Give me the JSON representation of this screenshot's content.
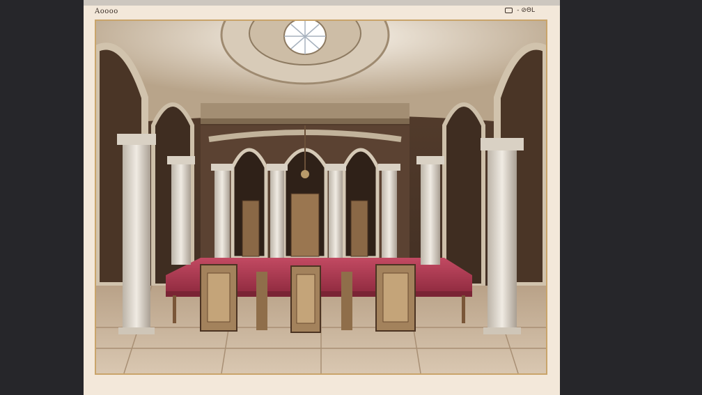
{
  "window": {
    "title": "Aoooo",
    "controls": {
      "glyphs": "- ⊘ΘL"
    }
  },
  "image": {
    "subject": "ornate-hall-illustration",
    "colors": {
      "page": "#f3e8da",
      "frame": "#c9a46a",
      "backdrop": "#26262a",
      "tablecloth": "#b33a52",
      "wood": "#7a5638",
      "marble": "#e6dfd3",
      "floor": "#c9b39a"
    }
  }
}
